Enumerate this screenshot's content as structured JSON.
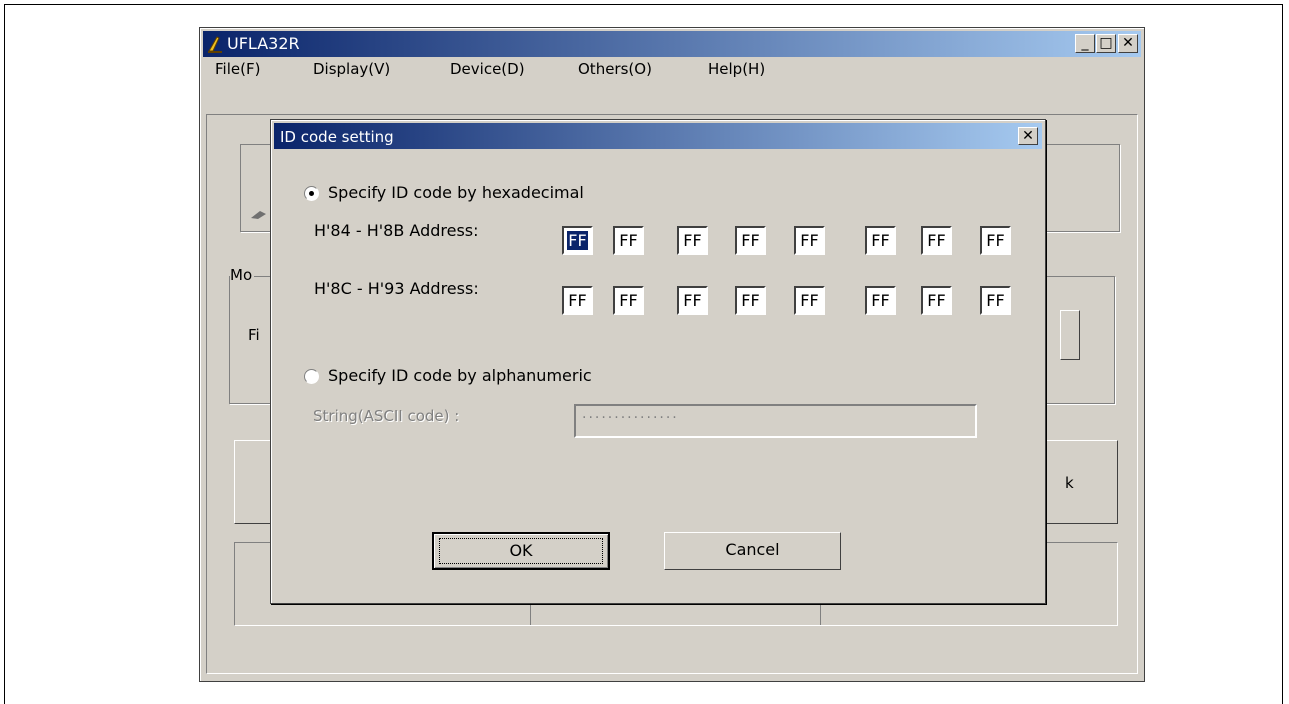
{
  "app": {
    "title": "UFLA32R"
  },
  "menu": [
    "File(F)",
    "Display(V)",
    "Device(D)",
    "Others(O)",
    "Help(H)"
  ],
  "background": {
    "mode_group_label": "Mo",
    "file_label": "Fi",
    "right_button_fragment": "k"
  },
  "dialog": {
    "title": "ID code setting",
    "radio_hex_label": "Specify ID code by hexadecimal",
    "row1_label": "H'84 - H'8B  Address:",
    "row2_label": "H'8C - H'93  Address:",
    "row1_values": [
      "FF",
      "FF",
      "FF",
      "FF",
      "FF",
      "FF",
      "FF",
      "FF"
    ],
    "row2_values": [
      "FF",
      "FF",
      "FF",
      "FF",
      "FF",
      "FF",
      "FF",
      "FF"
    ],
    "radio_alpha_label": "Specify ID code by alphanumeric",
    "string_label": "String(ASCII code) :",
    "string_value": "···············",
    "ok_label": "OK",
    "cancel_label": "Cancel",
    "hex_selected": true,
    "alpha_selected": false
  }
}
